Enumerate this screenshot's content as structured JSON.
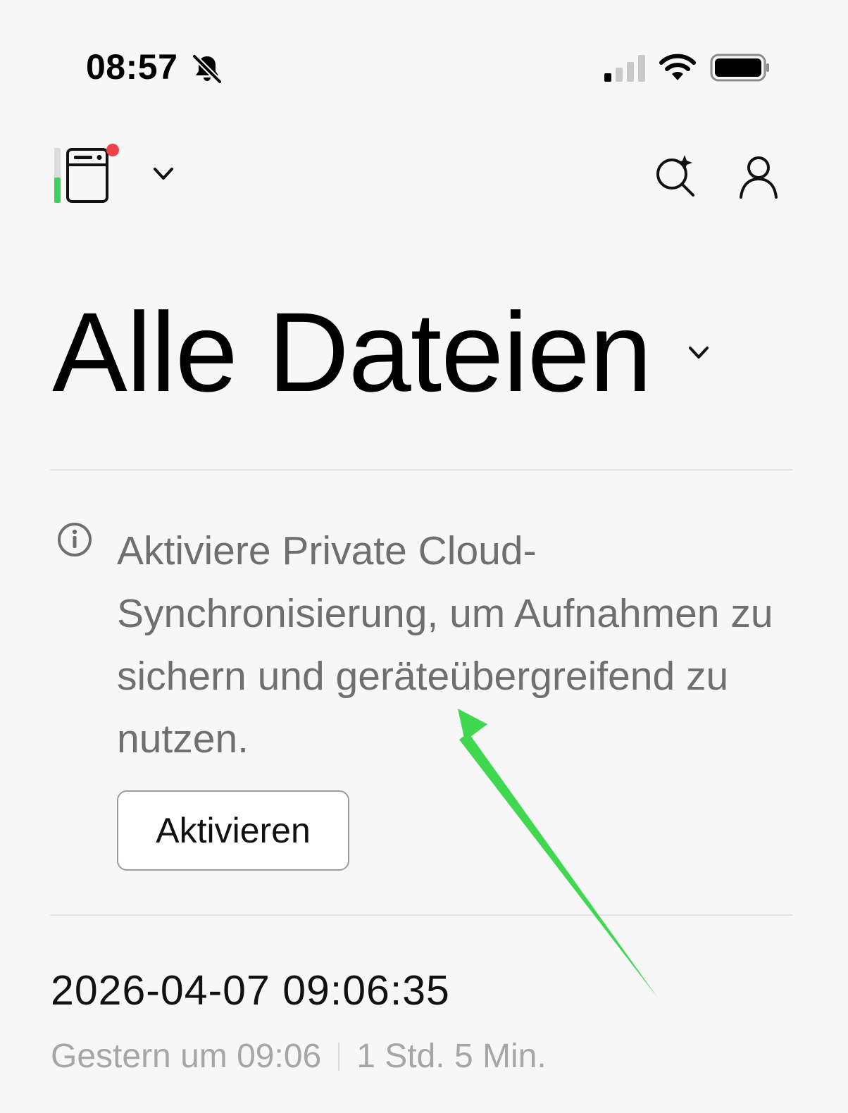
{
  "status_bar": {
    "time": "08:57",
    "bell_icon": "bell-slash-icon",
    "signal_icon": "cellular-signal-icon",
    "wifi_icon": "wifi-icon",
    "battery_icon": "battery-icon"
  },
  "header": {
    "device_icon": "recorder-device-icon",
    "device_chevron_icon": "chevron-down-icon",
    "search_icon": "ai-search-icon",
    "profile_icon": "user-icon",
    "notification_dot_color": "#f0424a",
    "battery_level_color": "#3bd15a"
  },
  "main": {
    "title": "Alle Dateien",
    "title_chevron_icon": "chevron-down-icon",
    "info_banner": {
      "icon": "info-icon",
      "text": "Aktiviere Private Cloud-Synchronisierung, um Aufnahmen zu sichern und geräteübergreifend zu nutzen.",
      "button_label": "Aktivieren"
    },
    "recordings": [
      {
        "title": "2026-04-07 09:06:35",
        "date": "Gestern um 09:06",
        "duration": "1 Std. 5 Min."
      }
    ]
  },
  "annotation": {
    "arrow_color": "#3fd84f"
  }
}
